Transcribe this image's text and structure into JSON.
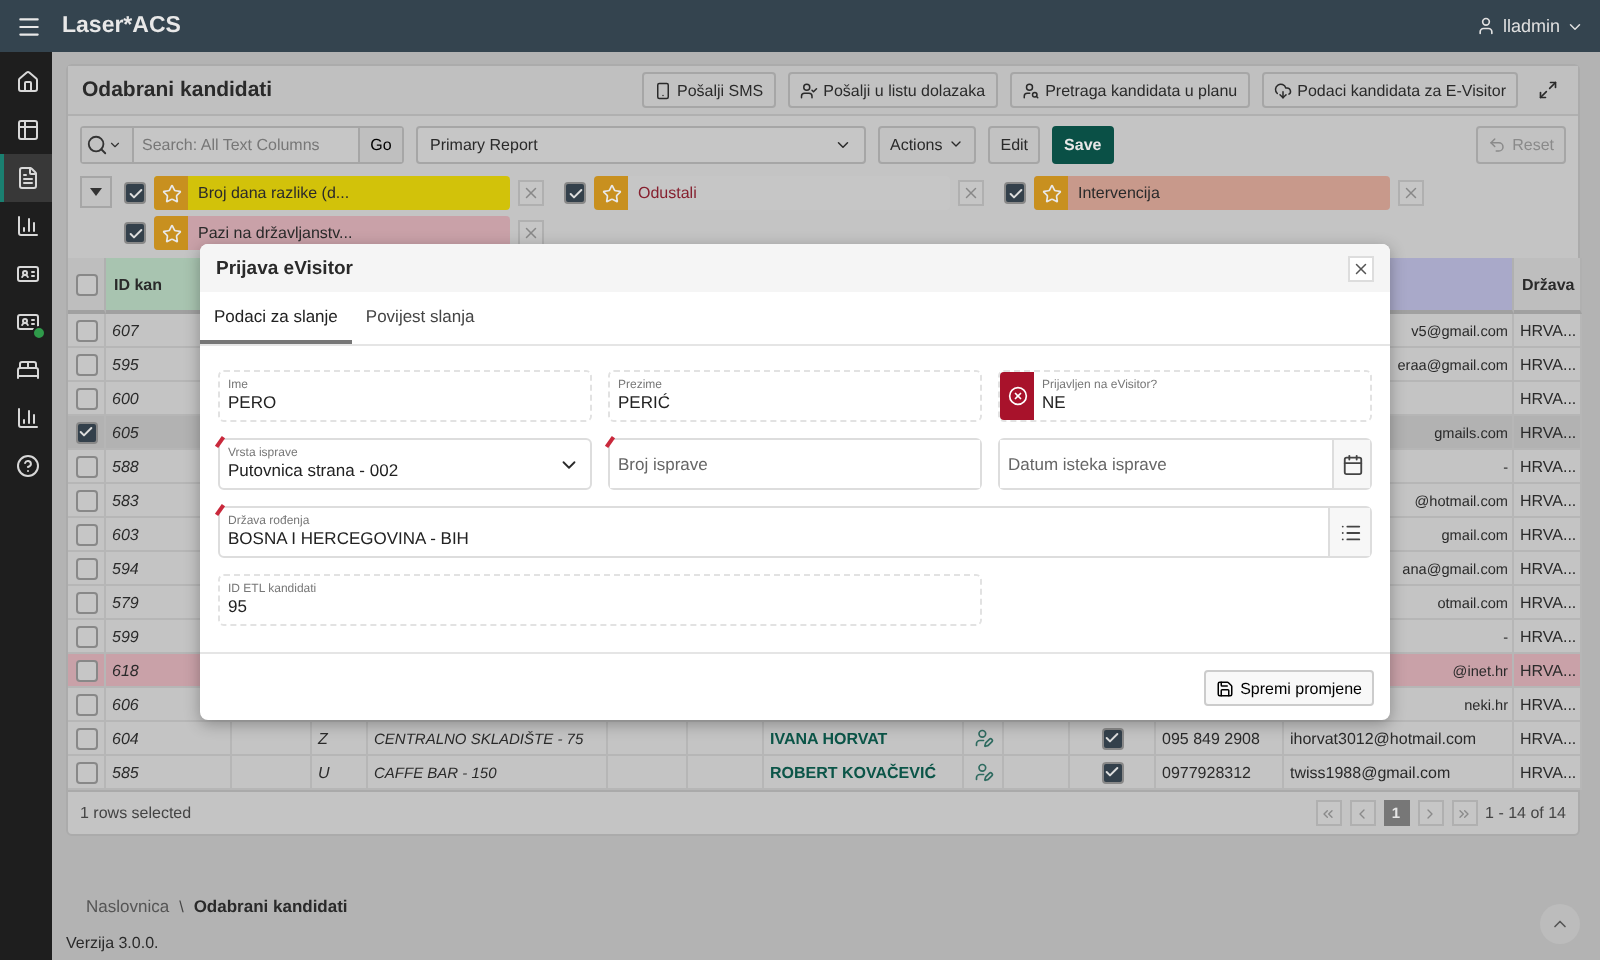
{
  "app": {
    "title": "Laser*ACS",
    "user": "lladmin"
  },
  "sidebar": {
    "items": [
      {
        "selected": false,
        "badge": false
      },
      {
        "selected": false,
        "badge": false
      },
      {
        "selected": true,
        "badge": false
      },
      {
        "selected": false,
        "badge": false
      },
      {
        "selected": false,
        "badge": false
      },
      {
        "selected": false,
        "badge": true
      },
      {
        "selected": false,
        "badge": false
      },
      {
        "selected": false,
        "badge": false
      },
      {
        "selected": false,
        "badge": false
      }
    ]
  },
  "region": {
    "title": "Odabrani kandidati",
    "buttons": [
      "Pošalji SMS",
      "Pošalji u listu dolazaka",
      "Pretraga kandidata u planu",
      "Podaci kandidata za E-Visitor"
    ]
  },
  "toolbar": {
    "search_placeholder": "Search: All Text Columns",
    "go": "Go",
    "report": "Primary Report",
    "actions": "Actions",
    "edit": "Edit",
    "save": "Save",
    "reset": "Reset",
    "reset_disabled": true
  },
  "filters": [
    {
      "label": "Broj dana razlike (d...",
      "checked": true,
      "color": "#d2c20a"
    },
    {
      "label": "Odustali",
      "checked": true,
      "color": "#c6c6c6"
    },
    {
      "label": "Intervencija",
      "checked": true,
      "color": "#c8998b"
    },
    {
      "label": "Pazi na državljanstv...",
      "checked": true,
      "color": "#c9a1a8"
    }
  ],
  "table": {
    "all_selected": false,
    "columns": {
      "id": "ID kan",
      "country": "Država"
    },
    "rows": [
      {
        "selected": false,
        "id": "607",
        "email": "v5@gmail.com",
        "country": "HRVA..."
      },
      {
        "selected": false,
        "id": "595",
        "email": "eraa@gmail.com",
        "country": "HRVA..."
      },
      {
        "selected": false,
        "id": "600",
        "country": "HRVA..."
      },
      {
        "selected": true,
        "id": "605",
        "email": "gmails.com",
        "country": "HRVA..."
      },
      {
        "selected": false,
        "id": "588",
        "email": "-",
        "country": "HRVA..."
      },
      {
        "selected": false,
        "id": "583",
        "email": "@hotmail.com",
        "country": "HRVA..."
      },
      {
        "selected": false,
        "id": "603",
        "email": "gmail.com",
        "country": "HRVA..."
      },
      {
        "selected": false,
        "id": "594",
        "email": "ana@gmail.com",
        "country": "HRVA..."
      },
      {
        "selected": false,
        "id": "579",
        "email": "otmail.com",
        "country": "HRVA..."
      },
      {
        "selected": false,
        "id": "599",
        "email": "-",
        "country": "HRVA..."
      },
      {
        "selected": false,
        "id": "618",
        "email": "@inet.hr",
        "country": "HRVA...",
        "color": "#c9a1a8"
      },
      {
        "selected": false,
        "id": "606",
        "email": "neki.hr",
        "country": "HRVA..."
      },
      {
        "selected": false,
        "id": "604",
        "type": "Z",
        "location": "CENTRALNO SKLADIŠTE - 75",
        "name": "IVANA HORVAT",
        "checked": true,
        "phone": "095 849 2908",
        "email": "ihorvat3012@hotmail.com",
        "country": "HRVA..."
      },
      {
        "selected": false,
        "id": "585",
        "type": "U",
        "location": "CAFFE BAR - 150",
        "name": "ROBERT KOVAČEVIĆ",
        "checked": true,
        "phone": "0977928312",
        "email": "twiss1988@gmail.com",
        "country": "HRVA..."
      }
    ],
    "selection": "1 rows selected",
    "page": "1",
    "range": "1 - 14 of 14"
  },
  "breadcrumb": {
    "parent": "Naslovnica",
    "separator": "\\",
    "current": "Odabrani kandidati"
  },
  "version": "Verzija 3.0.0.",
  "dialog": {
    "title": "Prijava eVisitor",
    "tabs": [
      {
        "label": "Podaci za slanje",
        "selected": true
      },
      {
        "label": "Povijest slanja",
        "selected": false
      }
    ],
    "rows": [
      [
        {
          "kind": "display",
          "label": "Ime",
          "value": "PERO",
          "required": false
        },
        {
          "kind": "display",
          "label": "Prezime",
          "value": "PERIĆ",
          "required": false
        },
        {
          "kind": "status",
          "label": "Prijavljen na eVisitor?",
          "value": "NE",
          "required": false
        }
      ],
      [
        {
          "kind": "select",
          "label": "Vrsta isprave",
          "value": "Putovnica strana - 002",
          "required": true
        },
        {
          "kind": "text",
          "placeholder": "Broj isprave",
          "required": true
        },
        {
          "kind": "date",
          "placeholder": "Datum isteka isprave",
          "required": false
        }
      ],
      [
        {
          "kind": "popup",
          "label": "Država rođenja",
          "value": "BOSNA I HERCEGOVINA - BIH",
          "required": true
        }
      ],
      [
        {
          "kind": "display",
          "label": "ID ETL kandidati",
          "value": "95",
          "required": false
        }
      ]
    ],
    "save": "Spremi promjene"
  }
}
